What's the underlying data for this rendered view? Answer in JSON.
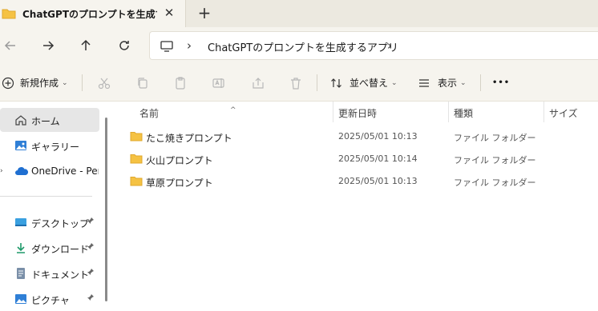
{
  "tab": {
    "title": "ChatGPTのプロンプトを生成するア",
    "close_glyph": "✕",
    "new_glyph": "+"
  },
  "address": {
    "crumb": "ChatGPTのプロンプトを生成するアプリ",
    "sep": "›"
  },
  "commands": {
    "new_label": "新規作成",
    "sort_label": "並べ替え",
    "view_label": "表示",
    "more_glyph": "•••",
    "chevron": "⌄"
  },
  "nav": {
    "items": [
      {
        "label": "ホーム",
        "icon": "home-icon",
        "selected": true
      },
      {
        "label": "ギャラリー",
        "icon": "gallery-icon"
      },
      {
        "label": "OneDrive - Perso",
        "icon": "onedrive-icon"
      },
      {
        "label": "デスクトップ",
        "icon": "desktop-icon",
        "pinned": true
      },
      {
        "label": "ダウンロード",
        "icon": "download-icon",
        "pinned": true
      },
      {
        "label": "ドキュメント",
        "icon": "documents-icon",
        "pinned": true
      },
      {
        "label": "ピクチャ",
        "icon": "pictures-icon",
        "pinned": true
      }
    ],
    "expander_glyph": "›",
    "pin_glyph": "📌"
  },
  "columns": {
    "name": "名前",
    "modified": "更新日時",
    "type": "種類",
    "size": "サイズ",
    "sort_glyph": "^"
  },
  "files": [
    {
      "name": "たこ焼きプロンプト",
      "modified": "2025/05/01 10:13",
      "type": "ファイル フォルダー"
    },
    {
      "name": "火山プロンプト",
      "modified": "2025/05/01 10:14",
      "type": "ファイル フォルダー"
    },
    {
      "name": "草原プロンプト",
      "modified": "2025/05/01 10:13",
      "type": "ファイル フォルダー"
    }
  ],
  "colors": {
    "folder": "#f5c243",
    "folder_dark": "#e0a82e",
    "accent": "#0067c0"
  }
}
